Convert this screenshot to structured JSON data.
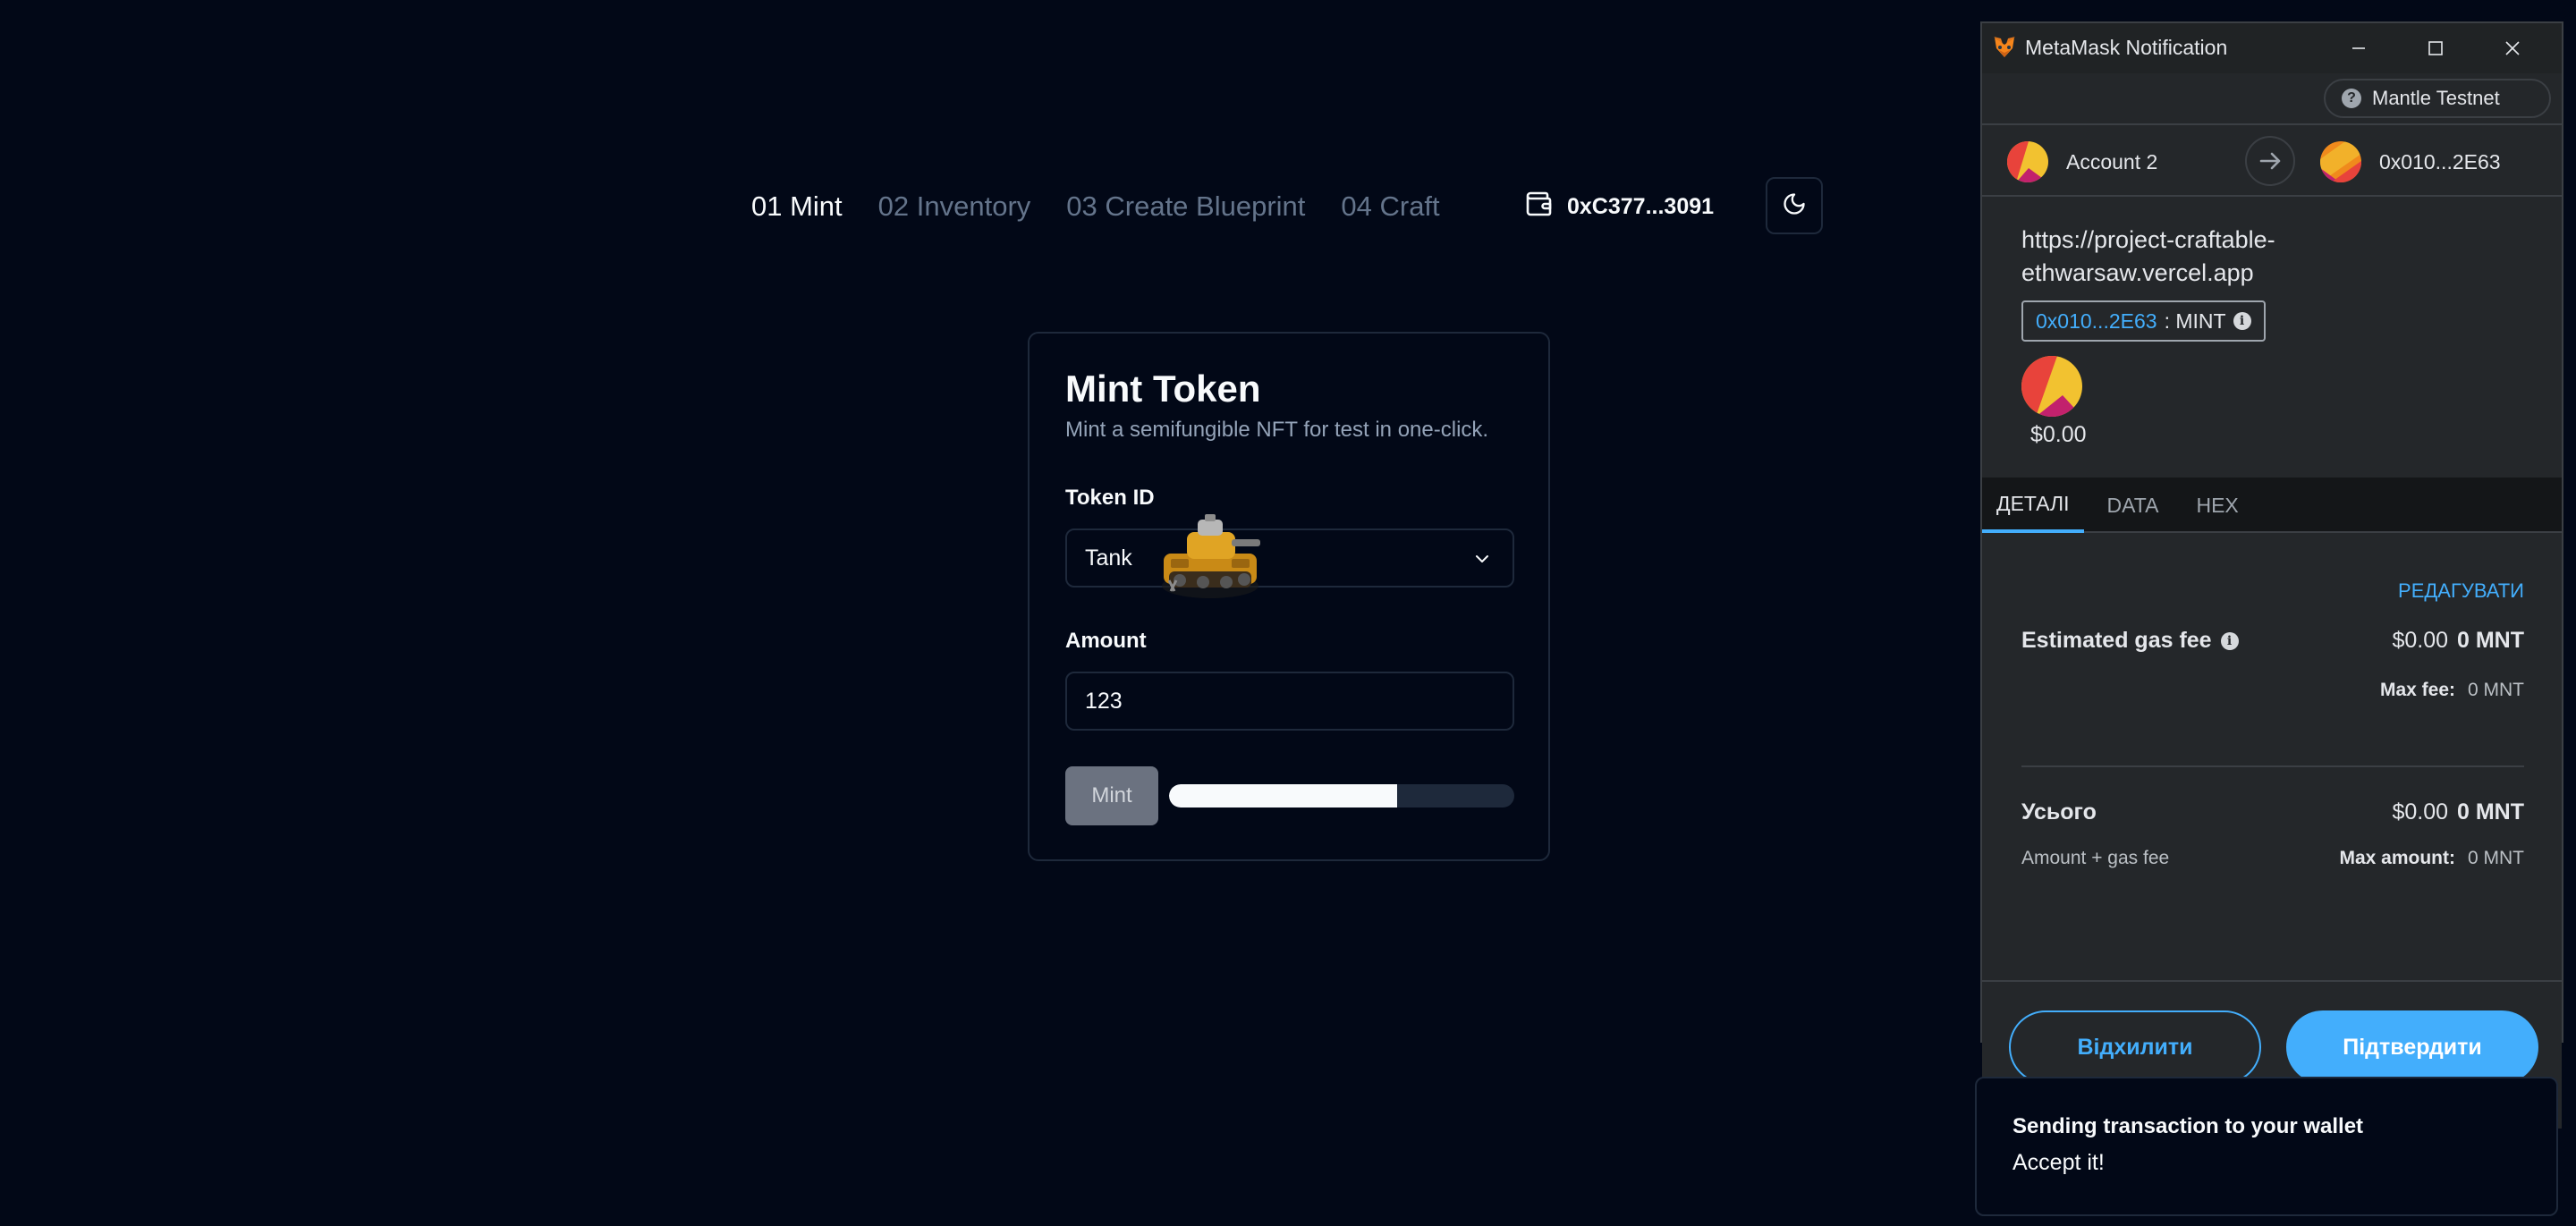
{
  "nav": {
    "items": [
      "01 Mint",
      "02 Inventory",
      "03 Create Blueprint",
      "04 Craft"
    ],
    "wallet_address": "0xC377...3091"
  },
  "mint_card": {
    "title": "Mint Token",
    "subtitle": "Mint a semifungible NFT for test in one-click.",
    "token_id_label": "Token ID",
    "token_id_value": "Tank",
    "amount_label": "Amount",
    "amount_value": "123",
    "mint_button": "Mint",
    "progress": 0.66
  },
  "metamask": {
    "window_title": "MetaMask Notification",
    "network": "Mantle Testnet",
    "from_account": "Account 2",
    "to_address": "0x010...2E63",
    "origin": "https://project-craftable-ethwarsaw.vercel.app",
    "method_address": "0x010...2E63",
    "method_name": ": MINT",
    "token_value": "$0.00",
    "tabs": [
      "ДЕТАЛІ",
      "DATA",
      "HEX"
    ],
    "edit_link": "РЕДАГУВАТИ",
    "gas_fee_label": "Estimated gas fee",
    "gas_fee_fiat": "$0.00",
    "gas_fee_native": "0 MNT",
    "max_fee_label": "Max fee:",
    "max_fee_value": "0 MNT",
    "total_label": "Усього",
    "total_fiat": "$0.00",
    "total_native": "0 MNT",
    "total_sub": "Amount + gas fee",
    "max_amount_label": "Max amount:",
    "max_amount_value": "0 MNT",
    "reject_button": "Відхилити",
    "confirm_button": "Підтвердити"
  },
  "toast": {
    "title": "Sending transaction to your wallet",
    "description": "Accept it!"
  },
  "colors": {
    "page_bg": "#020817",
    "accent_blue": "#43aefc",
    "metamask_bg": "#24272a"
  }
}
